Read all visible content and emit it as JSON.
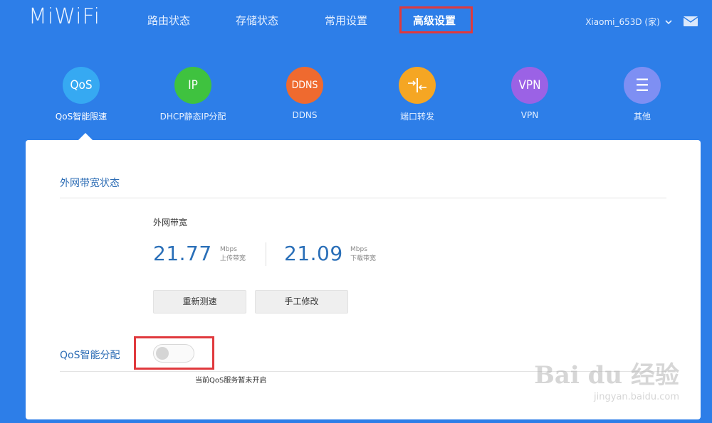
{
  "header": {
    "logo": "MiWiFi",
    "nav": [
      {
        "label": "路由状态"
      },
      {
        "label": "存储状态"
      },
      {
        "label": "常用设置"
      },
      {
        "label": "高级设置"
      }
    ],
    "router_name": "Xiaomi_653D (家)",
    "caret": "⌄"
  },
  "features": [
    {
      "glyph": "QoS",
      "label": "QoS智能限速",
      "color": "#36a9f2"
    },
    {
      "glyph": "IP",
      "label": "DHCP静态IP分配",
      "color": "#3fc23f"
    },
    {
      "glyph": "DDNS",
      "label": "DDNS",
      "color": "#ef6a2f"
    },
    {
      "glyph": "",
      "label": "端口转发",
      "color": "#f5a623"
    },
    {
      "glyph": "VPN",
      "label": "VPN",
      "color": "#9b62e5"
    },
    {
      "glyph": "☰",
      "label": "其他",
      "color": "#7e8ff3"
    }
  ],
  "panel": {
    "section_title": "外网带宽状态",
    "bandwidth_title": "外网带宽",
    "upload": {
      "value": "21.77",
      "unit": "Mbps",
      "caption": "上传带宽"
    },
    "download": {
      "value": "21.09",
      "unit": "Mbps",
      "caption": "下载带宽"
    },
    "retest_button": "重新测速",
    "manual_button": "手工修改",
    "qos_label": "QoS智能分配",
    "qos_status": "当前QoS服务暂未开启"
  },
  "watermark": {
    "big": "Bai du 经验",
    "small": "jingyan.baidu.com"
  },
  "colors": {
    "background": "#2d7ee8",
    "accent": "#2a6fb8",
    "highlight": "#e0393d"
  }
}
